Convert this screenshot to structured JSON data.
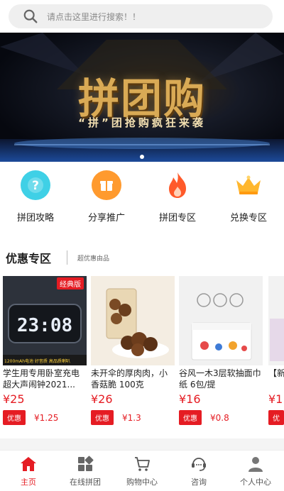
{
  "search": {
    "placeholder": "请点击这里进行搜索！！"
  },
  "banner": {
    "title": "拼团购",
    "subtitle": "“拼”团抢购疯狂来袭"
  },
  "categories": [
    {
      "label": "拼团攻略",
      "icon": "question-icon",
      "color": "#3fd0e6"
    },
    {
      "label": "分享推广",
      "icon": "gift-icon",
      "color": "#ff9a2e"
    },
    {
      "label": "拼团专区",
      "icon": "fire-icon",
      "color": "#ff5a2a"
    },
    {
      "label": "兑换专区",
      "icon": "crown-icon",
      "color": "#ffb72e"
    }
  ],
  "section": {
    "title": "优惠专区",
    "subtitle": "超优惠由品"
  },
  "products": [
    {
      "name": "学生用专用卧室充电超大声闹钟2021...",
      "price": "¥25",
      "tag": "优惠",
      "promo_price": "¥1.25",
      "badge": "经典版",
      "display_time": "23:08",
      "strip": "1200mAh电池  好音质  高品质喇叭"
    },
    {
      "name": "未开伞的厚肉肉，小香菇脆 100克",
      "price": "¥26",
      "tag": "优惠",
      "promo_price": "¥1.3"
    },
    {
      "name": "谷风一木3层软抽面巾纸 6包/提",
      "price": "¥16",
      "tag": "优惠",
      "promo_price": "¥0.8"
    },
    {
      "name": "【新能用",
      "price": "¥1",
      "tag": "优",
      "promo_price": ""
    }
  ],
  "nav": [
    {
      "label": "主页",
      "icon": "home-icon",
      "active": true
    },
    {
      "label": "在线拼团",
      "icon": "grid-icon",
      "active": false
    },
    {
      "label": "购物中心",
      "icon": "cart-icon",
      "active": false
    },
    {
      "label": "咨询",
      "icon": "chat-icon",
      "active": false
    },
    {
      "label": "个人中心",
      "icon": "user-icon",
      "active": false
    }
  ],
  "colors": {
    "accent": "#e51c23",
    "banner_gold": "#d9aa55"
  }
}
